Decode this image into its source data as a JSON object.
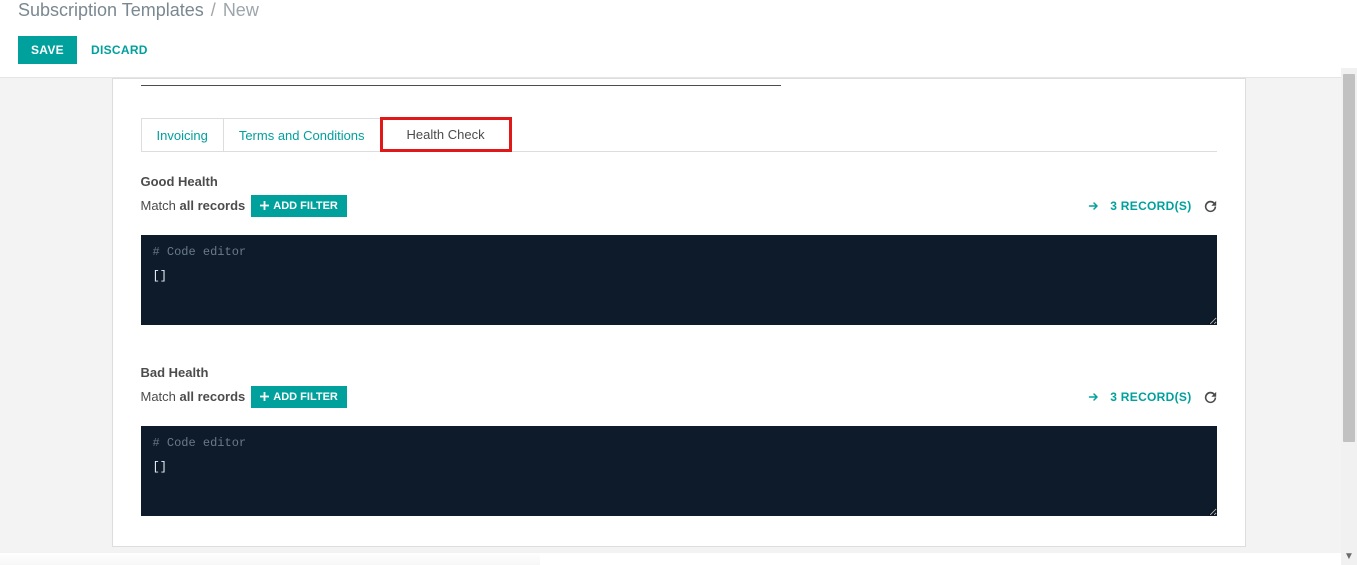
{
  "breadcrumb": {
    "root": "Subscription Templates",
    "sep": "/",
    "current": "New"
  },
  "actions": {
    "save": "SAVE",
    "discard": "DISCARD"
  },
  "tabs": {
    "invoicing": "Invoicing",
    "terms": "Terms and Conditions",
    "health": "Health Check"
  },
  "sections": {
    "good": {
      "title": "Good Health",
      "match_prefix": "Match ",
      "match_bold": "all records",
      "add_filter": "ADD FILTER",
      "records": "3 RECORD(S)",
      "code_comment": "# Code editor",
      "code_body": "[]"
    },
    "bad": {
      "title": "Bad Health",
      "match_prefix": "Match ",
      "match_bold": "all records",
      "add_filter": "ADD FILTER",
      "records": "3 RECORD(S)",
      "code_comment": "# Code editor",
      "code_body": "[]"
    }
  }
}
